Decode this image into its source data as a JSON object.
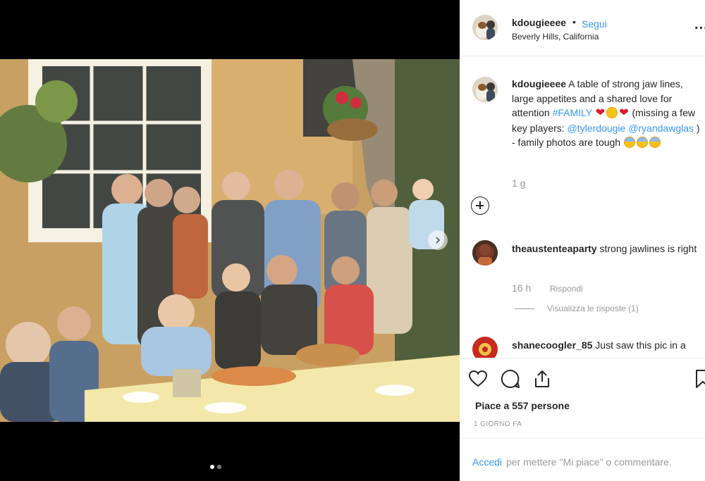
{
  "post": {
    "username": "kdougieeee",
    "bullet": "•",
    "follow_label": "Segui",
    "location": "Beverly Hills, California",
    "more_label": "...",
    "media_dots": 2,
    "media_active_index": 0
  },
  "caption": {
    "username": "kdougieeee",
    "text_part1": " A table of strong jaw lines, large appetites and a shared love for attention ",
    "hashtag": "#FAMILY",
    "text_part2": " (missing a few key players: ",
    "mention1": "@tylerdougie",
    "mention2": "@ryandawglas",
    "text_part3": " ) - family photos are tough",
    "time": "1 g"
  },
  "comments": [
    {
      "username": "theaustenteaparty",
      "text": " strong jawlines is right",
      "time": "16 h",
      "reply_label": "Rispondi",
      "view_replies_label": "Visualizza le risposte (1)"
    },
    {
      "username": "shanecoogler_85",
      "text": " Just saw this pic in a"
    }
  ],
  "actions": {
    "likes_text": "Piace a 557 persone",
    "time_ago": "1 GIORNO FA"
  },
  "login": {
    "link_label": "Accedi",
    "rest_text": " per mettere \"Mi piace\" o commentare."
  },
  "colors": {
    "link_blue": "#3897f0",
    "text": "#262626",
    "muted": "#999999"
  },
  "icons": [
    "avatar-image",
    "chevron-right-icon",
    "add-comment-icon",
    "heart-icon",
    "comment-icon",
    "share-icon",
    "bookmark-icon",
    "more-options-icon"
  ]
}
